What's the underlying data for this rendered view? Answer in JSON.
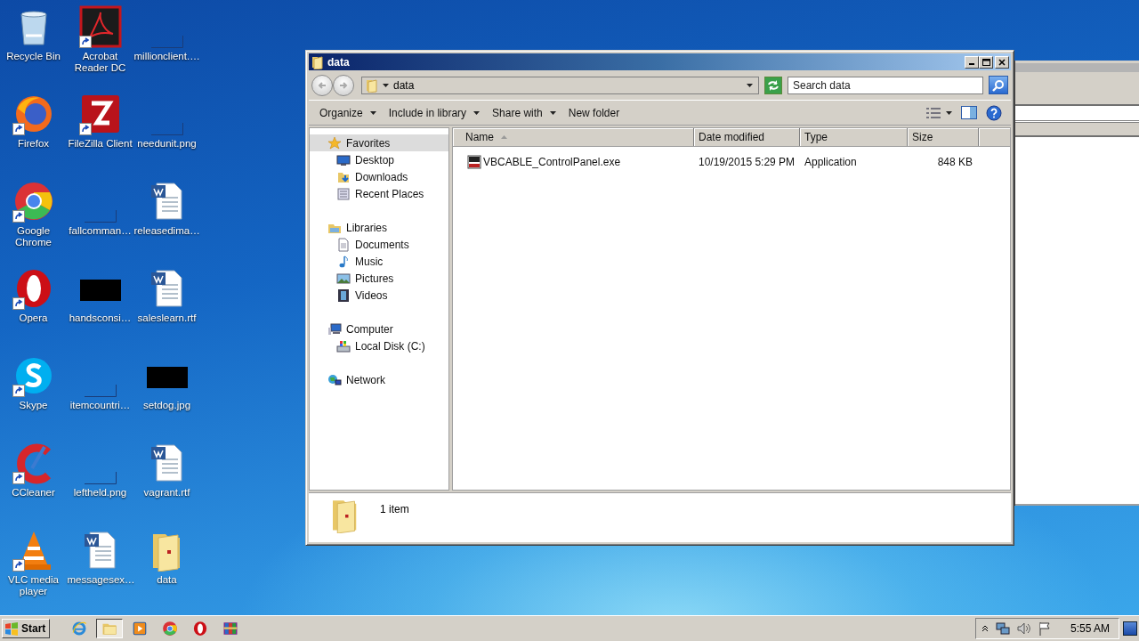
{
  "desktop": {
    "icons": [
      {
        "label": "Recycle Bin",
        "kind": "recycle",
        "shortcut": false
      },
      {
        "label": "Acrobat Reader DC",
        "kind": "acrobat",
        "shortcut": true
      },
      {
        "label": "millionclient.…",
        "kind": "blank",
        "shortcut": false
      },
      {
        "label": "Firefox",
        "kind": "firefox",
        "shortcut": true
      },
      {
        "label": "FileZilla Client",
        "kind": "filezilla",
        "shortcut": true
      },
      {
        "label": "needunit.png",
        "kind": "blank",
        "shortcut": false
      },
      {
        "label": "Google Chrome",
        "kind": "chrome",
        "shortcut": true
      },
      {
        "label": "fallcomman…",
        "kind": "blank",
        "shortcut": false
      },
      {
        "label": "releasedima…",
        "kind": "word",
        "shortcut": false
      },
      {
        "label": "Opera",
        "kind": "opera",
        "shortcut": true
      },
      {
        "label": "handsconsi…",
        "kind": "dark",
        "shortcut": false
      },
      {
        "label": "saleslearn.rtf",
        "kind": "word",
        "shortcut": false
      },
      {
        "label": "Skype",
        "kind": "skype",
        "shortcut": true
      },
      {
        "label": "itemcountri…",
        "kind": "blank",
        "shortcut": false
      },
      {
        "label": "setdog.jpg",
        "kind": "dark",
        "shortcut": false
      },
      {
        "label": "CCleaner",
        "kind": "ccleaner",
        "shortcut": true
      },
      {
        "label": "leftheld.png",
        "kind": "blank",
        "shortcut": false
      },
      {
        "label": "vagrant.rtf",
        "kind": "word",
        "shortcut": false
      },
      {
        "label": "VLC media player",
        "kind": "vlc",
        "shortcut": true
      },
      {
        "label": "messagesex…",
        "kind": "word",
        "shortcut": false
      },
      {
        "label": "data",
        "kind": "folder",
        "shortcut": false
      }
    ]
  },
  "window": {
    "title": "data",
    "address": "data",
    "search": {
      "placeholder": "Search data"
    },
    "toolbar": [
      {
        "label": "Organize",
        "menu": true
      },
      {
        "label": "Include in library",
        "menu": true
      },
      {
        "label": "Share with",
        "menu": true
      },
      {
        "label": "New folder",
        "menu": false
      }
    ],
    "nav": [
      {
        "label": "Favorites",
        "kind": "star",
        "selected": true,
        "children": [
          {
            "label": "Desktop",
            "kind": "desktop",
            "selected": false
          },
          {
            "label": "Downloads",
            "kind": "downloads",
            "selected": false
          },
          {
            "label": "Recent Places",
            "kind": "recent",
            "selected": false
          }
        ]
      },
      {
        "label": "Libraries",
        "kind": "libraries",
        "selected": false,
        "children": [
          {
            "label": "Documents",
            "kind": "documents",
            "selected": false
          },
          {
            "label": "Music",
            "kind": "music",
            "selected": false
          },
          {
            "label": "Pictures",
            "kind": "pictures",
            "selected": false
          },
          {
            "label": "Videos",
            "kind": "videos",
            "selected": false
          }
        ]
      },
      {
        "label": "Computer",
        "kind": "computer",
        "selected": false,
        "children": [
          {
            "label": "Local Disk (C:)",
            "kind": "disk",
            "selected": false
          }
        ]
      },
      {
        "label": "Network",
        "kind": "network",
        "selected": false
      }
    ],
    "columns": [
      {
        "label": "Name",
        "sorted": true
      },
      {
        "label": "Date modified",
        "sorted": false
      },
      {
        "label": "Type",
        "sorted": false
      },
      {
        "label": "Size",
        "sorted": false
      }
    ],
    "rows": [
      {
        "name": "VBCABLE_ControlPanel.exe",
        "date_modified": "10/19/2015 5:29 PM",
        "type": "Application",
        "size": "848 KB"
      }
    ],
    "details": "1 item"
  },
  "taskbar": {
    "start": "Start",
    "apps": [
      {
        "kind": "ie",
        "active": false
      },
      {
        "kind": "explorer",
        "active": true
      },
      {
        "kind": "media",
        "active": false
      },
      {
        "kind": "chrome",
        "active": false
      },
      {
        "kind": "opera",
        "active": false
      },
      {
        "kind": "winrar",
        "active": false
      }
    ],
    "time": "5:55 AM"
  }
}
